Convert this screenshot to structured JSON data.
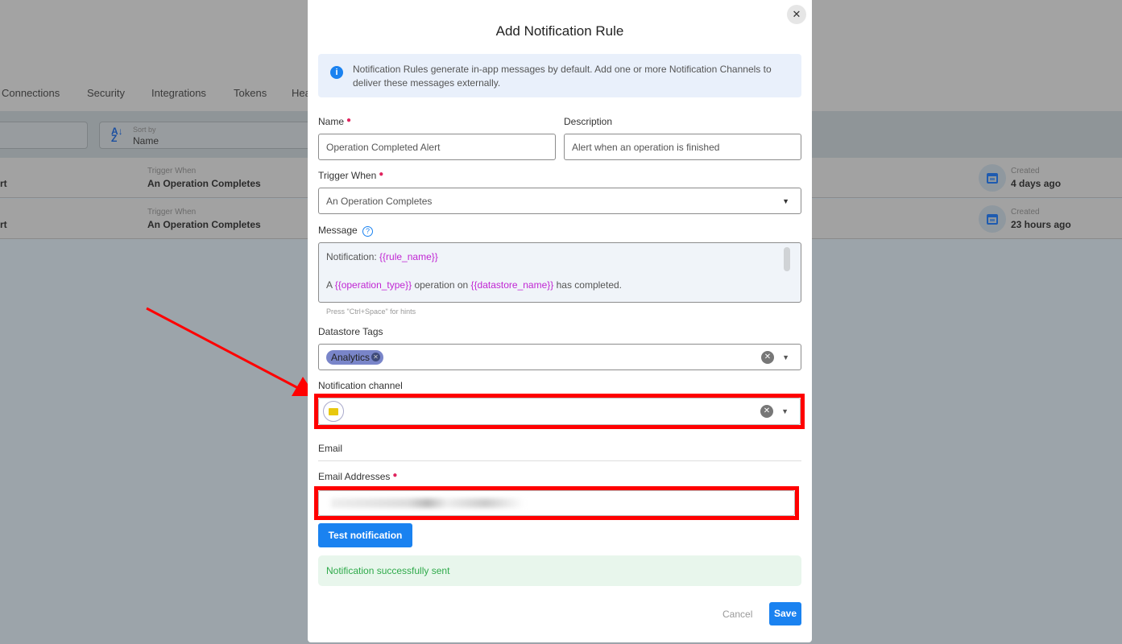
{
  "background": {
    "tabs": [
      "Connections",
      "Security",
      "Integrations",
      "Tokens",
      "Hea"
    ],
    "sort": {
      "label": "Sort by",
      "value": "Name"
    },
    "rows": [
      {
        "name": "rt",
        "trigger_label": "Trigger When",
        "trigger": "An Operation Completes",
        "created_label": "Created",
        "created": "4 days ago"
      },
      {
        "name": "rt",
        "trigger_label": "Trigger When",
        "trigger": "An Operation Completes",
        "created_label": "Created",
        "created": "23 hours ago"
      }
    ]
  },
  "modal": {
    "title": "Add Notification Rule",
    "info": "Notification Rules generate in-app messages by default. Add one or more Notification Channels to deliver these messages externally.",
    "name": {
      "label": "Name",
      "value": "Operation Completed Alert"
    },
    "description": {
      "label": "Description",
      "value": "Alert when an operation is finished"
    },
    "trigger": {
      "label": "Trigger When",
      "value": "An Operation Completes"
    },
    "message": {
      "label": "Message",
      "line1_prefix": "Notification: ",
      "line1_var": "{{rule_name}}",
      "line2_a": "A ",
      "line2_var1": "{{operation_type}}",
      "line2_b": " operation on ",
      "line2_var2": "{{datastore_name}}",
      "line2_c": " has completed.",
      "hint": "Press \"Ctrl+Space\" for hints"
    },
    "tags": {
      "label": "Datastore Tags",
      "chips": [
        "Analytics"
      ]
    },
    "channel": {
      "label": "Notification channel",
      "icon": "email-icon"
    },
    "email_section": "Email",
    "emails": {
      "label": "Email Addresses",
      "value": ""
    },
    "test_button": "Test notification",
    "success": "Notification successfully sent",
    "cancel": "Cancel",
    "save": "Save"
  },
  "colors": {
    "primary": "#1a82f0",
    "success_bg": "#e8f6ec",
    "success_text": "#2eaa4a",
    "annotation": "#ff0000",
    "chip": "#7985c9"
  }
}
